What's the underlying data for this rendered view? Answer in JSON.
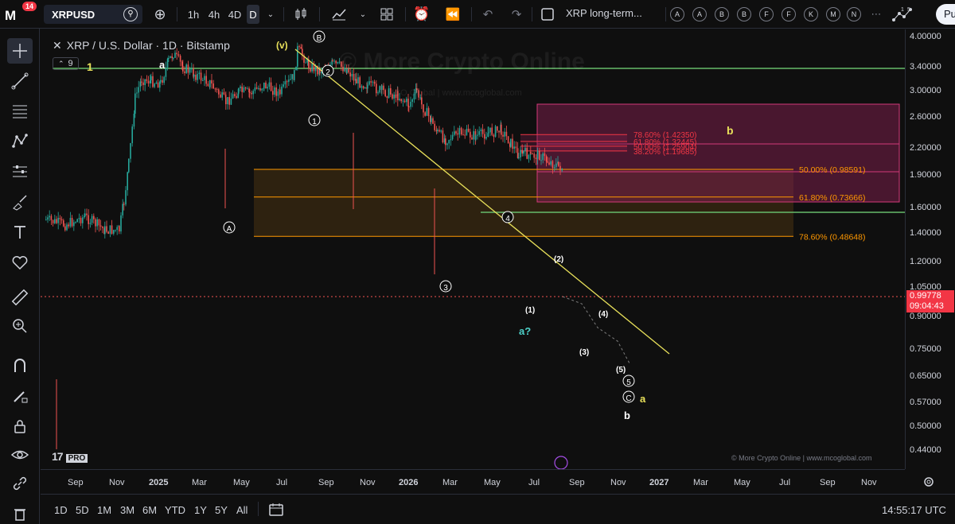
{
  "topbar": {
    "notification_count": "14",
    "symbol": "XRPUSD",
    "intervals": [
      "1h",
      "4h",
      "4D",
      "D"
    ],
    "active_interval": "D",
    "layout_name": "XRP long-term...",
    "indicator_letters": [
      "A",
      "A",
      "B",
      "B",
      "F",
      "F",
      "K",
      "M",
      "N"
    ],
    "publish_label": "Pu",
    "widget_numbers": [
      "1",
      "5"
    ]
  },
  "chart": {
    "title": "XRP / U.S. Dollar · 1D · Bitstamp",
    "indicator_count": "9",
    "watermark": "© More Crypto Online",
    "watermark_sub": "MCO Global  |  www.mcoglobal.com",
    "tv_logo": "17",
    "tv_pro": "PRO",
    "credit": "© More Crypto Online  |  www.mcoglobal.com",
    "wave_labels": {
      "w1": "1",
      "wa_top": "a",
      "wv": "(v)",
      "wB": "B",
      "w2c": "2",
      "w1c": "1",
      "wA": "A",
      "w3c": "3",
      "w4c": "4",
      "wp1": "(1)",
      "wp2": "(2)",
      "wa_q": "a?",
      "wp3": "(3)",
      "wp4": "(4)",
      "wp5": "(5)",
      "w5c": "5",
      "wC": "C",
      "wa_bot": "a",
      "wb_bot": "b",
      "wb_zone": "b"
    },
    "fib_upper": [
      {
        "label": "78.60% (1.42350)",
        "price": 1.4235
      },
      {
        "label": "61.80% (1.32445)",
        "price": 1.32445
      },
      {
        "label": "50.00% (1.25904)",
        "price": 1.25904
      },
      {
        "label": "38.20% (1.19685)",
        "price": 1.19685
      }
    ],
    "fib_lower": [
      {
        "label": "50.00% (0.98591)",
        "price": 0.98591
      },
      {
        "label": "61.80% (0.73666)",
        "price": 0.73666
      },
      {
        "label": "78.60% (0.48648)",
        "price": 0.48648
      }
    ],
    "colors": {
      "up": "#26a69a",
      "down": "#ef5350",
      "green_line": "#66bb6a",
      "trend_line": "#e8e05a",
      "fib_upper": "#f23645",
      "fib_lower": "#ff9800",
      "zone_b": "#7a1f4a",
      "zone_bottom": "#3a2a12"
    }
  },
  "price_axis": {
    "ticks": [
      "4.00000",
      "3.40000",
      "3.00000",
      "2.60000",
      "2.20000",
      "1.90000",
      "1.60000",
      "1.40000",
      "1.20000",
      "1.05000",
      "0.90000",
      "0.75000",
      "0.65000",
      "0.57000",
      "0.50000",
      "0.44000"
    ],
    "current_price": "0.99778",
    "countdown": "09:04:43"
  },
  "time_axis": {
    "ticks": [
      "Sep",
      "Nov",
      "2025",
      "Mar",
      "May",
      "Jul",
      "Sep",
      "Nov",
      "2026",
      "Mar",
      "May",
      "Jul",
      "Sep",
      "Nov",
      "2027",
      "Mar",
      "May",
      "Jul",
      "Sep",
      "Nov"
    ]
  },
  "bottombar": {
    "ranges": [
      "1D",
      "5D",
      "1M",
      "3M",
      "6M",
      "YTD",
      "1Y",
      "5Y",
      "All"
    ],
    "clock": "14:55:17 UTC"
  }
}
